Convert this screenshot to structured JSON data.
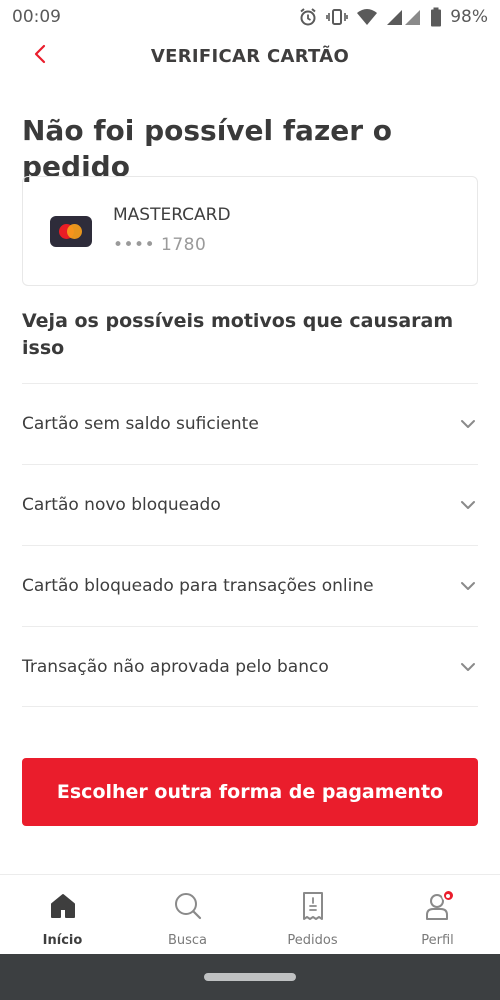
{
  "status_bar": {
    "time": "00:09",
    "battery": "98%"
  },
  "header": {
    "title": "VERIFICAR CARTÃO"
  },
  "page": {
    "title": "Não foi possível fazer o pedido"
  },
  "card": {
    "brand": "MASTERCARD",
    "number": "•••• 1780"
  },
  "reasons": {
    "title": "Veja os possíveis motivos que causaram isso",
    "items": [
      {
        "label": "Cartão sem saldo suficiente"
      },
      {
        "label": "Cartão novo bloqueado"
      },
      {
        "label": "Cartão bloqueado para transações online"
      },
      {
        "label": "Transação não aprovada pelo banco"
      }
    ]
  },
  "cta": {
    "label": "Escolher outra forma de pagamento"
  },
  "bottom_nav": {
    "items": [
      {
        "label": "Início",
        "icon": "home-icon",
        "active": true
      },
      {
        "label": "Busca",
        "icon": "search-icon"
      },
      {
        "label": "Pedidos",
        "icon": "orders-icon"
      },
      {
        "label": "Perfil",
        "icon": "profile-icon",
        "badge": true
      }
    ]
  },
  "colors": {
    "accent": "#ea1d2c",
    "text": "#3e3e3e",
    "muted": "#9a9a9a",
    "system_bar": "#3c3f41"
  }
}
